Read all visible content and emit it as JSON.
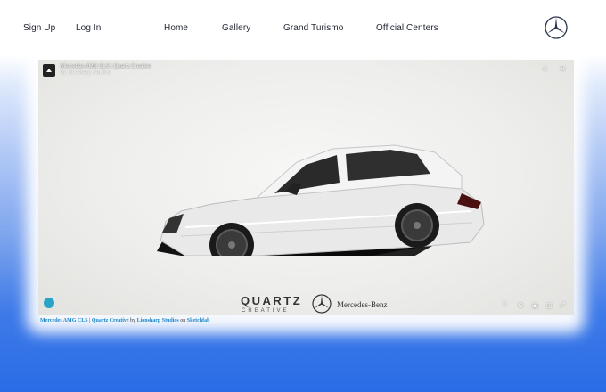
{
  "nav": {
    "sign_up": "Sign Up",
    "log_in": "Log In",
    "home": "Home",
    "gallery": "Gallery",
    "grand_turismo": "Grand Turismo",
    "official_centers": "Official Centers"
  },
  "viewer": {
    "title": "Mercedes AMG CLS | Quartz Creative",
    "subtitle": "by Lionsharp Studios",
    "brand_quartz": "QUARTZ",
    "brand_creative": "CREATIVE",
    "brand_mercedes": "Mercedes-Benz"
  },
  "credit": {
    "model_link": "Mercedes AMG CLS | Quartz Creative",
    "by": "by",
    "author_link": "Lionsharp Studios",
    "on": "on",
    "platform_link": "Sketchfab"
  },
  "colors": {
    "accent": "#2a6ce6",
    "link": "#1b86c9"
  }
}
